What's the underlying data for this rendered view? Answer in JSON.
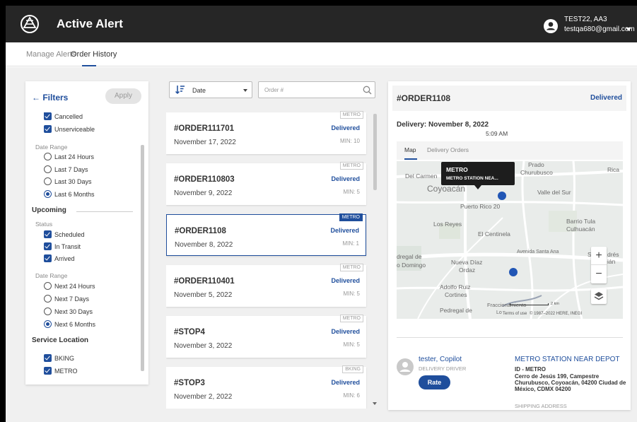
{
  "app": {
    "title": "Active Alert",
    "user_name": "TEST22, AA3",
    "user_email": "testqa680@gmail.com"
  },
  "tabs": [
    {
      "label": "Manage Alerts",
      "active": false
    },
    {
      "label": "Order History",
      "active": true
    }
  ],
  "filters": {
    "title": "Filters",
    "apply_label": "Apply",
    "past_status": [
      {
        "label": "Cancelled",
        "checked": true
      },
      {
        "label": "Unserviceable",
        "checked": true
      }
    ],
    "past_date_range_label": "Date Range",
    "past_date_range": [
      {
        "label": "Last 24 Hours",
        "selected": false
      },
      {
        "label": "Last 7 Days",
        "selected": false
      },
      {
        "label": "Last 30 Days",
        "selected": false
      },
      {
        "label": "Last 6 Months",
        "selected": true
      }
    ],
    "upcoming_title": "Upcoming",
    "upcoming_status_label": "Status",
    "upcoming_status": [
      {
        "label": "Scheduled",
        "checked": true
      },
      {
        "label": "In Transit",
        "checked": true
      },
      {
        "label": "Arrived",
        "checked": true
      }
    ],
    "upcoming_date_range_label": "Date Range",
    "upcoming_date_range": [
      {
        "label": "Next 24 Hours",
        "selected": false
      },
      {
        "label": "Next 7 Days",
        "selected": false
      },
      {
        "label": "Next 30 Days",
        "selected": false
      },
      {
        "label": "Next 6 Months",
        "selected": true
      }
    ],
    "service_location_title": "Service Location",
    "service_locations": [
      {
        "label": "BKING",
        "checked": true
      },
      {
        "label": "METRO",
        "checked": true
      }
    ]
  },
  "sort": {
    "label": "Date"
  },
  "search": {
    "placeholder": "Order #",
    "value": ""
  },
  "orders": [
    {
      "id": "#ORDER111701",
      "date": "November 17, 2022",
      "status": "Delivered",
      "min": "MIN: 10",
      "tag": "METRO",
      "selected": false
    },
    {
      "id": "#ORDER110803",
      "date": "November 9, 2022",
      "status": "Delivered",
      "min": "MIN: 5",
      "tag": "METRO",
      "selected": false
    },
    {
      "id": "#ORDER1108",
      "date": "November 8, 2022",
      "status": "Delivered",
      "min": "MIN: 1",
      "tag": "METRO",
      "selected": true
    },
    {
      "id": "#ORDER110401",
      "date": "November 5, 2022",
      "status": "Delivered",
      "min": "MIN: 5",
      "tag": "METRO",
      "selected": false
    },
    {
      "id": "#STOP4",
      "date": "November 3, 2022",
      "status": "Delivered",
      "min": "MIN: 5",
      "tag": "METRO",
      "selected": false
    },
    {
      "id": "#STOP3",
      "date": "November 2, 2022",
      "status": "Delivered",
      "min": "MIN: 6",
      "tag": "BKING",
      "selected": false
    }
  ],
  "detail": {
    "order_id": "#ORDER1108",
    "status": "Delivered",
    "delivery_label": "Delivery: November 8, 2022",
    "delivery_time": "5:09 AM",
    "tabs": [
      {
        "label": "Map",
        "active": true
      },
      {
        "label": "Delivery Orders",
        "active": false
      }
    ],
    "map": {
      "tooltip_title": "METRO",
      "tooltip_subtitle": "METRO STATION NEA...",
      "labels": {
        "del_carmen": "Del Carmen",
        "prado": "Prado",
        "churubusco": "Churubusco",
        "rica": "Rica",
        "coyoacan": "Coyoacán",
        "valle_del_sur": "Valle del Sur",
        "puerto_rico": "Puerto Rico 20",
        "los_reyes": "Los Reyes",
        "barrio_tula": "Barrio Tula",
        "culhuacan": "Culhuacán",
        "el_centinela": "El Centinela",
        "avenida_santa_ana": "Avenida Santa Ana",
        "dregal": "dregal de",
        "domingo": "o Domingo",
        "nueva_diaz": "Nueva Díaz",
        "ordaz": "Ordaz",
        "adolfo_ruiz": "Adolfo Ruiz",
        "cortines": "Cortines",
        "pedregal": "Pedregal de",
        "fraccionamiento": "Fraccionamiento",
        "lo": "Lo",
        "s_left": "S",
        "dres": "drés",
        "an": "ián"
      },
      "scale_label": "2 km",
      "terms": "Terms of use",
      "copyright": "© 1987–2022 HERE, INEGI",
      "zoom_in": "+",
      "zoom_out": "−"
    },
    "driver": {
      "name": "tester, Copilot",
      "role": "DELIVERY DRIVER",
      "rate_label": "Rate"
    },
    "location": {
      "name": "METRO STATION NEAR DEPOT",
      "id": "ID - METRO",
      "address": "Cerro de Jesús 199, Campestre Churubusco, Coyoacán, 04200 Ciudad de México, CDMX 04200",
      "type": "SHIPPING ADDRESS"
    }
  },
  "colors": {
    "accent": "#1f4e9c",
    "topbar": "#262626",
    "pin": "#2156b5"
  }
}
